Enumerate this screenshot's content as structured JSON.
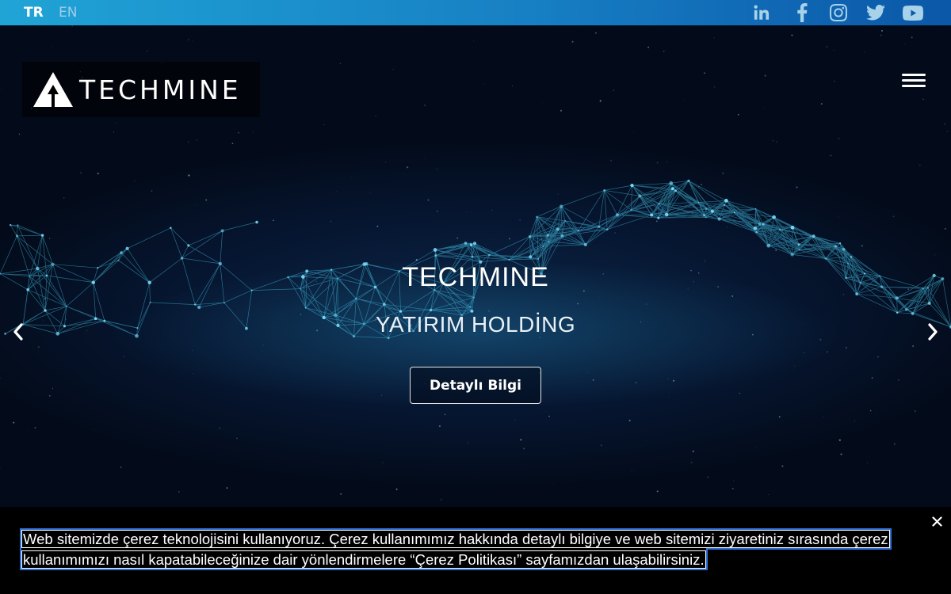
{
  "topbar": {
    "languages": [
      {
        "code": "TR",
        "active": true
      },
      {
        "code": "EN",
        "active": false
      }
    ],
    "social_icons": [
      "linkedin-icon",
      "facebook-icon",
      "instagram-icon",
      "twitter-icon",
      "youtube-icon"
    ]
  },
  "header": {
    "logo_text": "TECHMINE",
    "menu_icon": "hamburger-menu-icon"
  },
  "hero": {
    "title": "TECHMINE",
    "subtitle": "YATIRIM HOLDİNG",
    "button_label": "Detaylı Bilgi",
    "prev_icon": "chevron-left-icon",
    "next_icon": "chevron-right-icon"
  },
  "cookie": {
    "text": "Web sitemizde çerez teknolojisini kullanıyoruz. Çerez kullanımımız hakkında detaylı bilgiye ve web sitemizi ziyaretiniz sırasında çerez kullanımımızı nasıl kapatabileceğinize dair yönlendirmelere “Çerez Politikası” sayfamızdan ulaşabilirsiniz.",
    "close_icon": "close-icon"
  },
  "colors": {
    "topbar_start": "#20a4d6",
    "topbar_end": "#0b57a8",
    "social_icon": "#a7d2ea",
    "network_line": "#3fb6d8",
    "cookie_bg": "#000000",
    "focus_outline": "#2f6fd6"
  }
}
